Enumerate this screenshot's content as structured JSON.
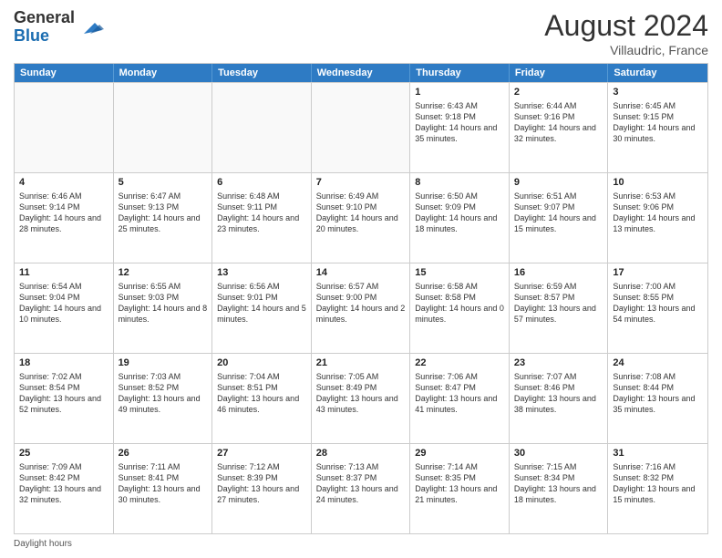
{
  "header": {
    "logo_line1": "General",
    "logo_line2": "Blue",
    "month_year": "August 2024",
    "location": "Villaudric, France"
  },
  "days_of_week": [
    "Sunday",
    "Monday",
    "Tuesday",
    "Wednesday",
    "Thursday",
    "Friday",
    "Saturday"
  ],
  "footer": {
    "daylight_label": "Daylight hours"
  },
  "weeks": [
    [
      {
        "day": "",
        "empty": true
      },
      {
        "day": "",
        "empty": true
      },
      {
        "day": "",
        "empty": true
      },
      {
        "day": "",
        "empty": true
      },
      {
        "day": "1",
        "sunrise": "6:43 AM",
        "sunset": "9:18 PM",
        "daylight": "14 hours and 35 minutes."
      },
      {
        "day": "2",
        "sunrise": "6:44 AM",
        "sunset": "9:16 PM",
        "daylight": "14 hours and 32 minutes."
      },
      {
        "day": "3",
        "sunrise": "6:45 AM",
        "sunset": "9:15 PM",
        "daylight": "14 hours and 30 minutes."
      }
    ],
    [
      {
        "day": "4",
        "sunrise": "6:46 AM",
        "sunset": "9:14 PM",
        "daylight": "14 hours and 28 minutes."
      },
      {
        "day": "5",
        "sunrise": "6:47 AM",
        "sunset": "9:13 PM",
        "daylight": "14 hours and 25 minutes."
      },
      {
        "day": "6",
        "sunrise": "6:48 AM",
        "sunset": "9:11 PM",
        "daylight": "14 hours and 23 minutes."
      },
      {
        "day": "7",
        "sunrise": "6:49 AM",
        "sunset": "9:10 PM",
        "daylight": "14 hours and 20 minutes."
      },
      {
        "day": "8",
        "sunrise": "6:50 AM",
        "sunset": "9:09 PM",
        "daylight": "14 hours and 18 minutes."
      },
      {
        "day": "9",
        "sunrise": "6:51 AM",
        "sunset": "9:07 PM",
        "daylight": "14 hours and 15 minutes."
      },
      {
        "day": "10",
        "sunrise": "6:53 AM",
        "sunset": "9:06 PM",
        "daylight": "14 hours and 13 minutes."
      }
    ],
    [
      {
        "day": "11",
        "sunrise": "6:54 AM",
        "sunset": "9:04 PM",
        "daylight": "14 hours and 10 minutes."
      },
      {
        "day": "12",
        "sunrise": "6:55 AM",
        "sunset": "9:03 PM",
        "daylight": "14 hours and 8 minutes."
      },
      {
        "day": "13",
        "sunrise": "6:56 AM",
        "sunset": "9:01 PM",
        "daylight": "14 hours and 5 minutes."
      },
      {
        "day": "14",
        "sunrise": "6:57 AM",
        "sunset": "9:00 PM",
        "daylight": "14 hours and 2 minutes."
      },
      {
        "day": "15",
        "sunrise": "6:58 AM",
        "sunset": "8:58 PM",
        "daylight": "14 hours and 0 minutes."
      },
      {
        "day": "16",
        "sunrise": "6:59 AM",
        "sunset": "8:57 PM",
        "daylight": "13 hours and 57 minutes."
      },
      {
        "day": "17",
        "sunrise": "7:00 AM",
        "sunset": "8:55 PM",
        "daylight": "13 hours and 54 minutes."
      }
    ],
    [
      {
        "day": "18",
        "sunrise": "7:02 AM",
        "sunset": "8:54 PM",
        "daylight": "13 hours and 52 minutes."
      },
      {
        "day": "19",
        "sunrise": "7:03 AM",
        "sunset": "8:52 PM",
        "daylight": "13 hours and 49 minutes."
      },
      {
        "day": "20",
        "sunrise": "7:04 AM",
        "sunset": "8:51 PM",
        "daylight": "13 hours and 46 minutes."
      },
      {
        "day": "21",
        "sunrise": "7:05 AM",
        "sunset": "8:49 PM",
        "daylight": "13 hours and 43 minutes."
      },
      {
        "day": "22",
        "sunrise": "7:06 AM",
        "sunset": "8:47 PM",
        "daylight": "13 hours and 41 minutes."
      },
      {
        "day": "23",
        "sunrise": "7:07 AM",
        "sunset": "8:46 PM",
        "daylight": "13 hours and 38 minutes."
      },
      {
        "day": "24",
        "sunrise": "7:08 AM",
        "sunset": "8:44 PM",
        "daylight": "13 hours and 35 minutes."
      }
    ],
    [
      {
        "day": "25",
        "sunrise": "7:09 AM",
        "sunset": "8:42 PM",
        "daylight": "13 hours and 32 minutes."
      },
      {
        "day": "26",
        "sunrise": "7:11 AM",
        "sunset": "8:41 PM",
        "daylight": "13 hours and 30 minutes."
      },
      {
        "day": "27",
        "sunrise": "7:12 AM",
        "sunset": "8:39 PM",
        "daylight": "13 hours and 27 minutes."
      },
      {
        "day": "28",
        "sunrise": "7:13 AM",
        "sunset": "8:37 PM",
        "daylight": "13 hours and 24 minutes."
      },
      {
        "day": "29",
        "sunrise": "7:14 AM",
        "sunset": "8:35 PM",
        "daylight": "13 hours and 21 minutes."
      },
      {
        "day": "30",
        "sunrise": "7:15 AM",
        "sunset": "8:34 PM",
        "daylight": "13 hours and 18 minutes."
      },
      {
        "day": "31",
        "sunrise": "7:16 AM",
        "sunset": "8:32 PM",
        "daylight": "13 hours and 15 minutes."
      }
    ]
  ]
}
